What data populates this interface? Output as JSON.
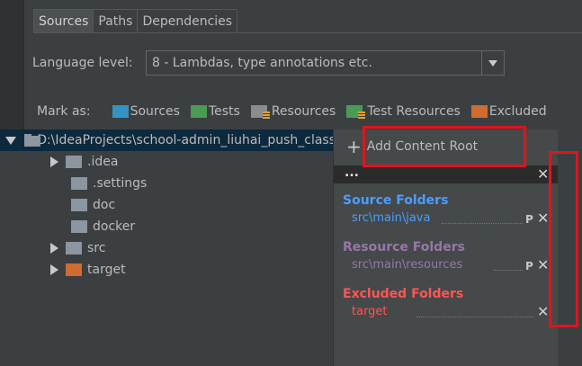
{
  "tabs": [
    {
      "label": "Sources",
      "active": true
    },
    {
      "label": "Paths",
      "active": false
    },
    {
      "label": "Dependencies",
      "active": false
    }
  ],
  "language_level": {
    "label": "Language level:",
    "value": "8 - Lambdas, type annotations etc."
  },
  "mark_as": {
    "label": "Mark as:",
    "items": [
      {
        "label": "Sources",
        "icon": "sources-folder-icon",
        "color": "#3592c4"
      },
      {
        "label": "Tests",
        "icon": "tests-folder-icon",
        "color": "#499c54"
      },
      {
        "label": "Resources",
        "icon": "resources-folder-icon",
        "color": "#8c8c8c"
      },
      {
        "label": "Test Resources",
        "icon": "test-resources-folder-icon",
        "color": "#499c54"
      },
      {
        "label": "Excluded",
        "icon": "excluded-folder-icon",
        "color": "#d06b32"
      }
    ]
  },
  "tree": {
    "root": "D:\\IdeaProjects\\school-admin_liuhai_push_class",
    "children": [
      {
        "label": ".idea",
        "expandable": true,
        "color": "#8c96a0"
      },
      {
        "label": ".settings",
        "expandable": false,
        "color": "#8c96a0"
      },
      {
        "label": "doc",
        "expandable": false,
        "color": "#8c96a0"
      },
      {
        "label": "docker",
        "expandable": false,
        "color": "#8c96a0"
      },
      {
        "label": "src",
        "expandable": true,
        "color": "#8c96a0"
      },
      {
        "label": "target",
        "expandable": true,
        "color": "#d06b32"
      }
    ]
  },
  "content_root": {
    "add_label": "Add Content Root",
    "header": "...",
    "source_folders": {
      "title": "Source Folders",
      "path": "src\\main\\java",
      "color": "#4a9eff"
    },
    "resource_folders": {
      "title": "Resource Folders",
      "path": "src\\main\\resources",
      "color": "#9876aa"
    },
    "excluded_folders": {
      "title": "Excluded Folders",
      "path": "target",
      "color": "#ff5555"
    }
  },
  "colors": {
    "background": "#3c3f41",
    "panel": "#45494a",
    "selection": "#0d293e",
    "highlight": "#e0141e"
  }
}
